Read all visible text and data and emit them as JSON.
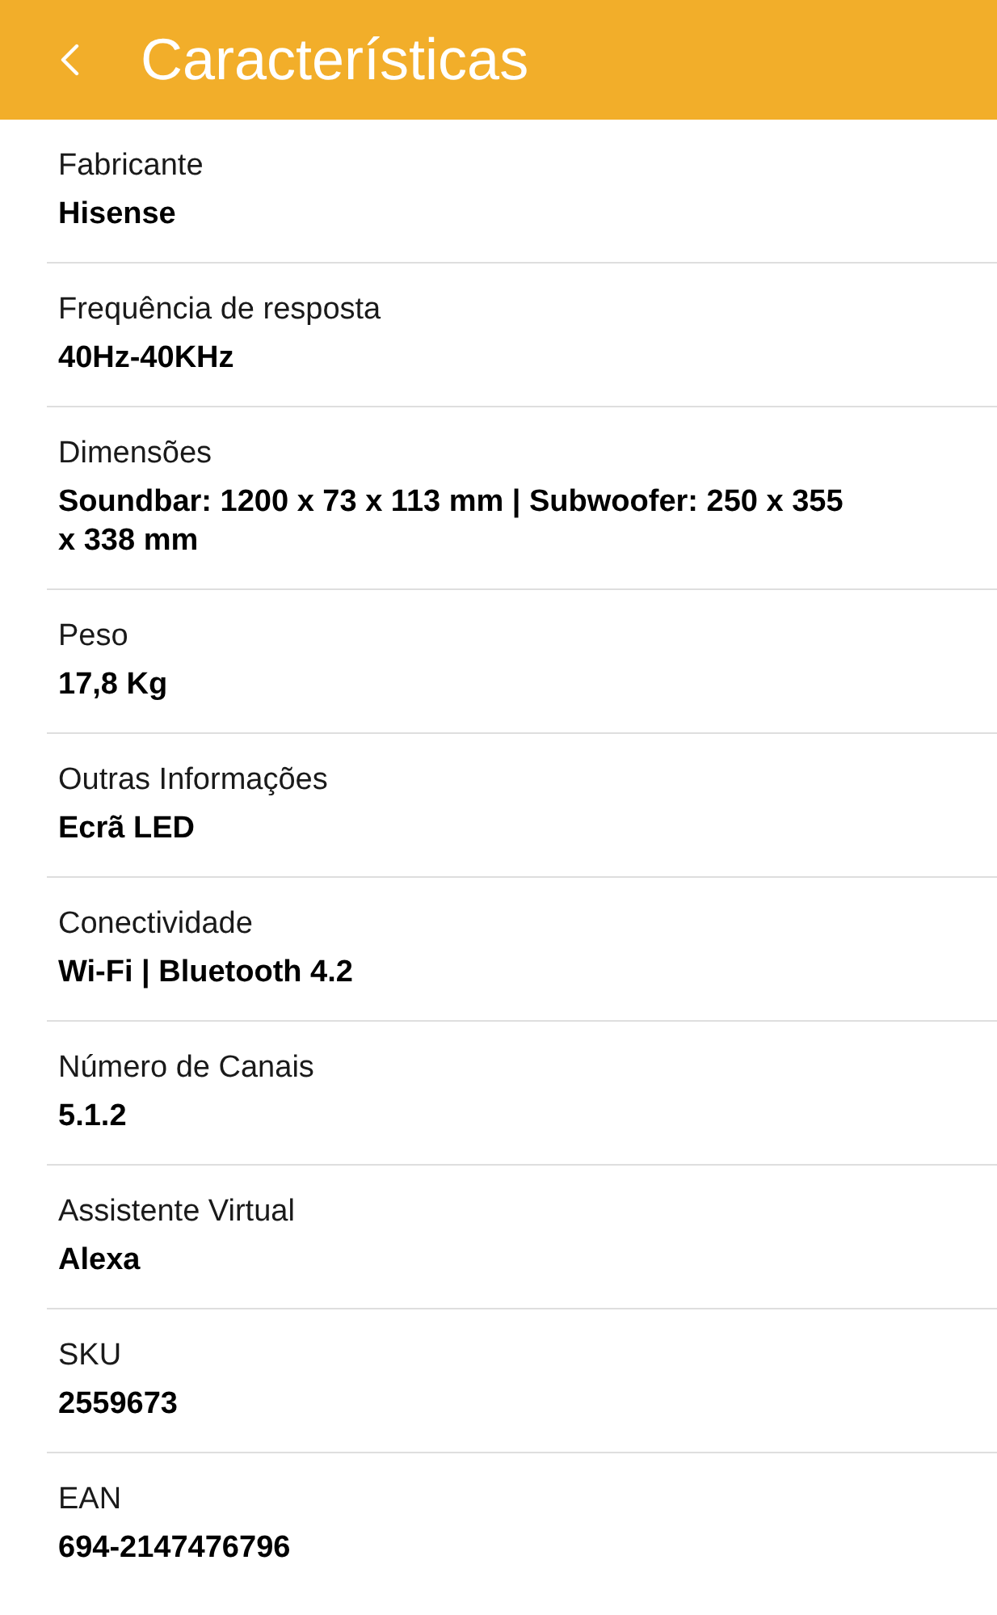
{
  "header": {
    "title": "Características"
  },
  "specs": [
    {
      "label": "Fabricante",
      "value": "Hisense"
    },
    {
      "label": "Frequência de resposta",
      "value": "40Hz-40KHz"
    },
    {
      "label": "Dimensões",
      "value": "Soundbar: 1200 x 73 x 113 mm | Subwoofer: 250 x 355 x 338 mm"
    },
    {
      "label": "Peso",
      "value": "17,8 Kg"
    },
    {
      "label": "Outras Informações",
      "value": "Ecrã LED"
    },
    {
      "label": "Conectividade",
      "value": "Wi-Fi | Bluetooth 4.2"
    },
    {
      "label": "Número de Canais",
      "value": "5.1.2"
    },
    {
      "label": "Assistente Virtual",
      "value": "Alexa"
    },
    {
      "label": "SKU",
      "value": "2559673"
    },
    {
      "label": "EAN",
      "value": "694-2147476796"
    }
  ]
}
